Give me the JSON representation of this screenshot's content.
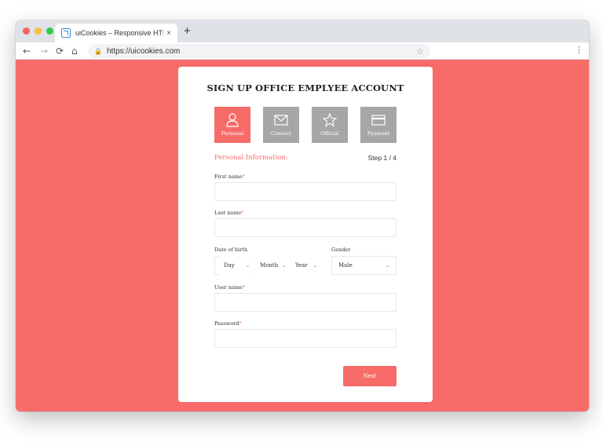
{
  "browser": {
    "tab_title": "uiCookies – Responsive HTML",
    "tab_close": "×",
    "new_tab": "+",
    "url": "https://uicookies.com",
    "nav": {
      "back": "←",
      "forward": "→",
      "reload": "⟳",
      "home": "⌂"
    },
    "lock": "🔒",
    "star": "☆",
    "menu": "⋮"
  },
  "form": {
    "title": "SIGN UP OFFICE EMPLYEE ACCOUNT",
    "steps": [
      {
        "label": "Personal",
        "icon": "user-icon",
        "active": true
      },
      {
        "label": "Contact",
        "icon": "envelope-icon",
        "active": false
      },
      {
        "label": "Official",
        "icon": "star-icon",
        "active": false
      },
      {
        "label": "Payment",
        "icon": "credit-card-icon",
        "active": false
      }
    ],
    "section_title": "Personal Information:",
    "step_counter": "Step 1 / 4",
    "required_mark": "*",
    "fields": {
      "first_name": {
        "label": "First name",
        "value": ""
      },
      "last_name": {
        "label": "Last name",
        "value": ""
      },
      "dob": {
        "label": "Date of birth",
        "day": "Day",
        "month": "Month",
        "year": "Year"
      },
      "gender": {
        "label": "Gender",
        "value": "Male"
      },
      "user_name": {
        "label": "User name",
        "value": ""
      },
      "password": {
        "label": "Password",
        "value": ""
      }
    },
    "next_label": "Next"
  },
  "colors": {
    "accent": "#f76b69",
    "inactive_step": "#a6a6a6",
    "background": "#f76b69"
  }
}
